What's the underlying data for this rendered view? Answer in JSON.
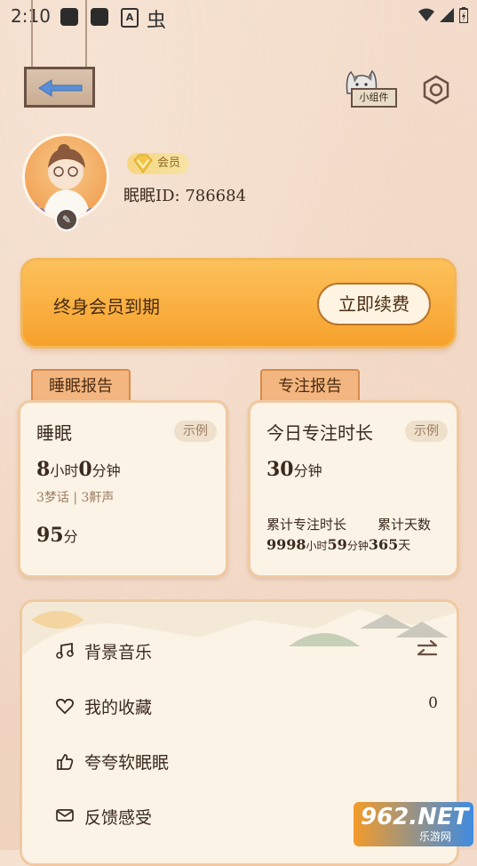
{
  "status_bar": {
    "time": "2:10",
    "a_icon": "A",
    "bug_icon": "虫"
  },
  "header": {
    "widget_label": "小组件"
  },
  "profile": {
    "vip_label": "会员",
    "user_id": "眠眠ID: 786684"
  },
  "membership": {
    "status_text": "终身会员到期",
    "renew_label": "立即续费"
  },
  "sleep_report": {
    "tab_label": "睡眠报告",
    "title": "睡眠",
    "sample_tag": "示例",
    "hours": "8",
    "hours_unit": "小时",
    "minutes": "0",
    "minutes_unit": "分钟",
    "events": "3梦话 | 3鼾声",
    "score": "95",
    "score_unit": "分"
  },
  "focus_report": {
    "tab_label": "专注报告",
    "title": "今日专注时长",
    "sample_tag": "示例",
    "minutes": "30",
    "minutes_unit": "分钟",
    "total_label": "累计专注时长",
    "days_label": "累计天数",
    "total_hours": "9998",
    "total_hours_unit": "小时",
    "total_minutes": "59",
    "total_minutes_unit": "分钟",
    "total_days": "365",
    "total_days_unit": "天"
  },
  "menu": {
    "items": [
      {
        "label": "背景音乐",
        "icon": "music-note-icon"
      },
      {
        "label": "我的收藏",
        "icon": "heart-icon",
        "count": "0"
      },
      {
        "label": "夸夸软眠眠",
        "icon": "thumbs-up-icon"
      },
      {
        "label": "反馈感受",
        "icon": "mail-icon"
      }
    ]
  },
  "watermark": {
    "main": "962.NET",
    "sub": "乐游网"
  },
  "colors": {
    "accent": "#f7a12c",
    "card_border": "#f0c9a1",
    "tab_bg": "#f4b680"
  }
}
